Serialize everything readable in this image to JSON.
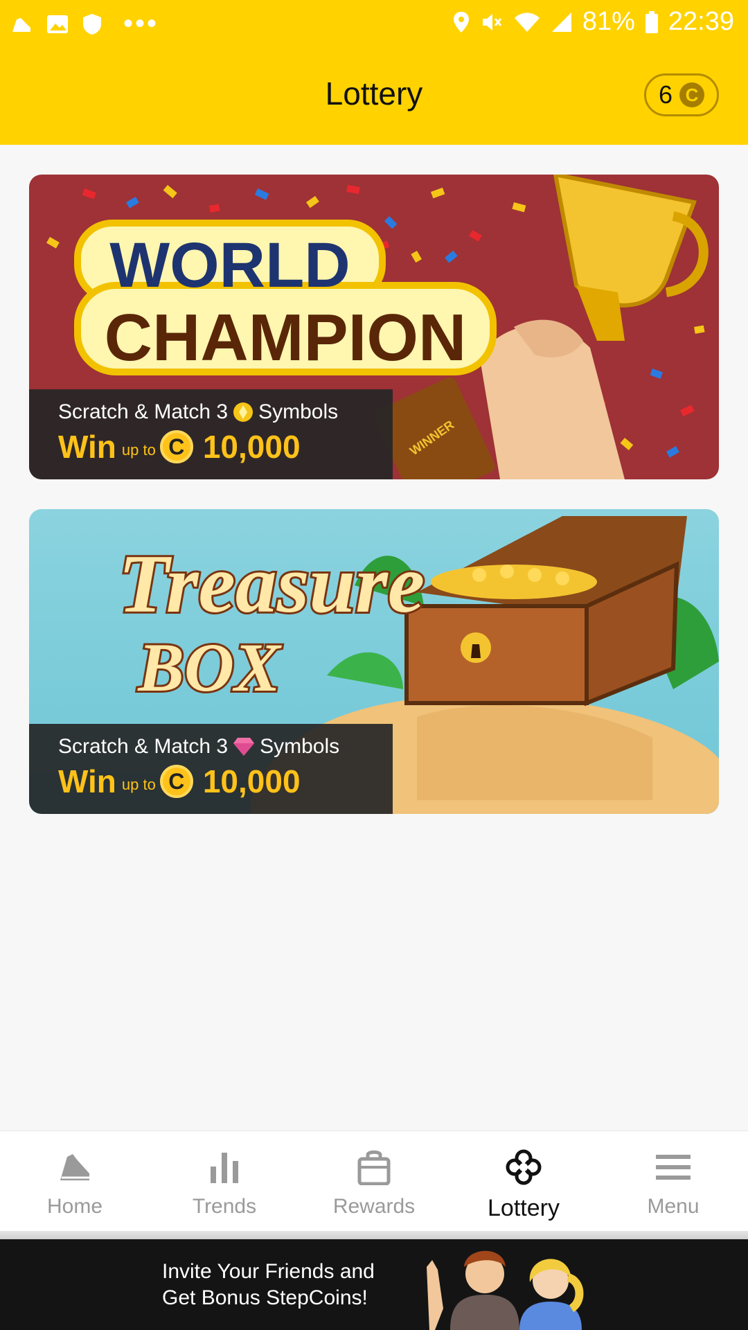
{
  "status_bar": {
    "battery": "81%",
    "time": "22:39"
  },
  "header": {
    "title": "Lottery",
    "coin_count": "6",
    "coin_symbol": "C"
  },
  "cards": [
    {
      "title_line1": "WORLD",
      "title_line2": "CHAMPION",
      "badge": "WINNER",
      "desc_prefix": "Scratch & Match 3",
      "desc_suffix": "Symbols",
      "win": "Win",
      "up_to": "up to",
      "amount": "10,000"
    },
    {
      "title_line1": "Treasure",
      "title_line2": "BOX",
      "desc_prefix": "Scratch & Match 3",
      "desc_suffix": "Symbols",
      "win": "Win",
      "up_to": "up to",
      "amount": "10,000"
    }
  ],
  "nav": [
    {
      "label": "Home",
      "icon": "shoe-icon"
    },
    {
      "label": "Trends",
      "icon": "bar-chart-icon"
    },
    {
      "label": "Rewards",
      "icon": "shopping-bag-icon"
    },
    {
      "label": "Lottery",
      "icon": "clover-icon",
      "active": true
    },
    {
      "label": "Menu",
      "icon": "hamburger-icon"
    }
  ],
  "banner": {
    "line1": "Invite Your Friends and",
    "line2": "Get Bonus StepCoins!"
  },
  "colors": {
    "accent": "#ffd200",
    "gold": "#ffc21a",
    "card1_bg": "#9e3236",
    "card2_bg": "#8bd3df"
  }
}
